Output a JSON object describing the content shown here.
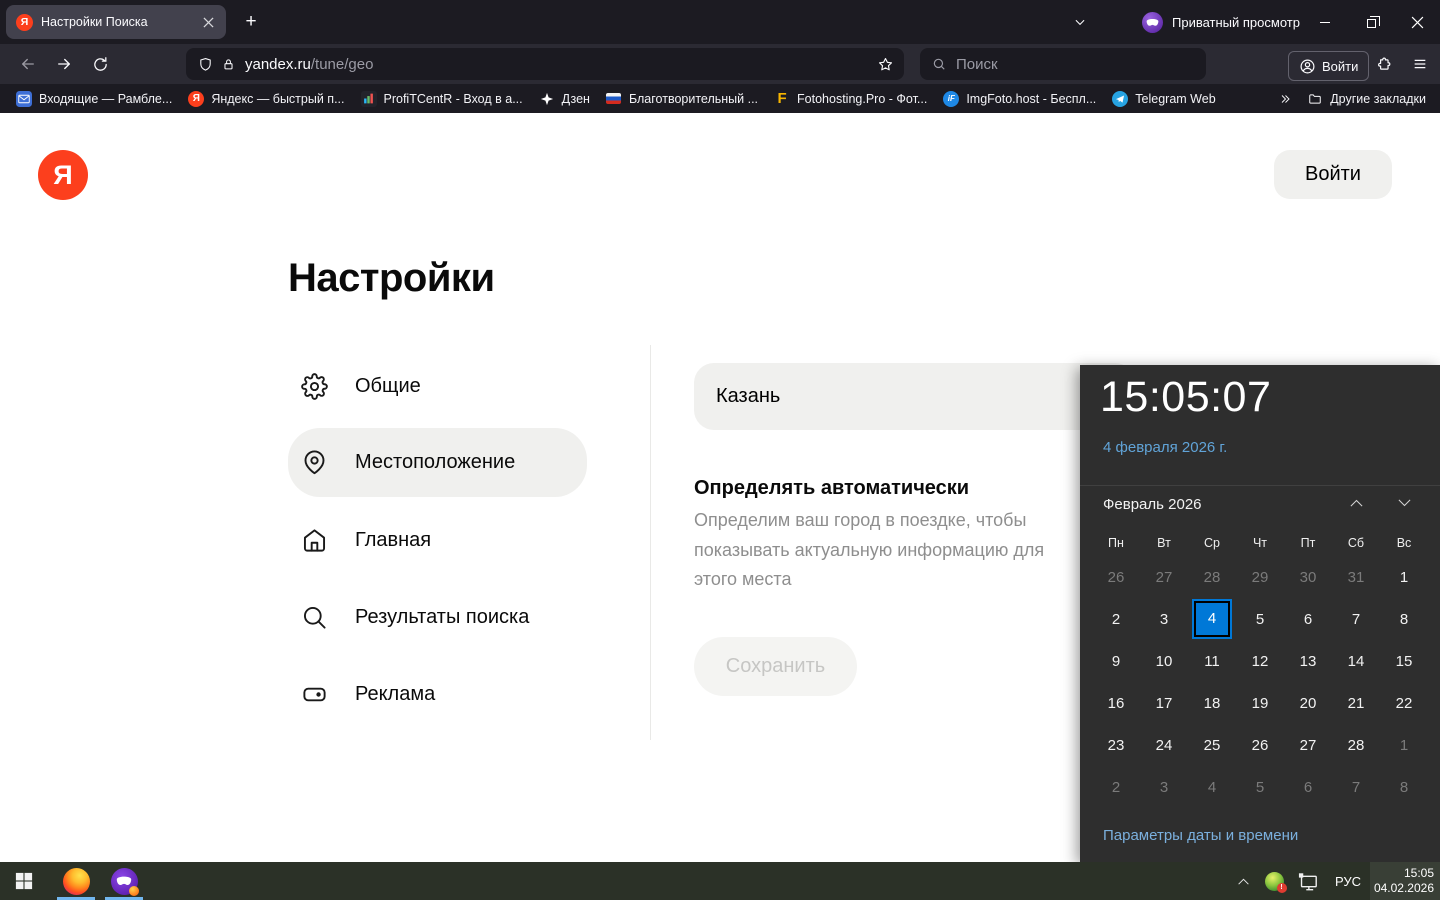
{
  "browser": {
    "tab": {
      "title": "Настройки Поиска"
    },
    "private_mode_label": "Приватный просмотр",
    "address": {
      "domain": "yandex.ru",
      "path": "/tune/geo"
    },
    "search_placeholder": "Поиск",
    "toolbar_signin_label": "Войти",
    "bookmarks": [
      {
        "icon": "mail",
        "label": "Входящие — Рамбле..."
      },
      {
        "icon": "yandex",
        "label": "Яндекс — быстрый п..."
      },
      {
        "icon": "chart",
        "label": "ProfiTCentR - Вход в а..."
      },
      {
        "icon": "zen",
        "label": "Дзен"
      },
      {
        "icon": "flag",
        "label": "Благотворительный ..."
      },
      {
        "icon": "foto",
        "label": "Fotohosting.Pro - Фот..."
      },
      {
        "icon": "imgfoto",
        "label": "ImgFoto.host - Беспл..."
      },
      {
        "icon": "telegram",
        "label": "Telegram Web"
      }
    ],
    "other_bookmarks_label": "Другие закладки"
  },
  "page": {
    "logo_letter": "Я",
    "signin_button_label": "Войти",
    "title": "Настройки",
    "sidebar": [
      {
        "id": "general",
        "icon": "gear",
        "label": "Общие",
        "active": false
      },
      {
        "id": "location",
        "icon": "pin",
        "label": "Местоположение",
        "active": true
      },
      {
        "id": "home",
        "icon": "home",
        "label": "Главная",
        "active": false
      },
      {
        "id": "results",
        "icon": "search",
        "label": "Результаты поиска",
        "active": false
      },
      {
        "id": "ads",
        "icon": "tag",
        "label": "Реклама",
        "active": false
      }
    ],
    "location_form": {
      "city_value": "Казань",
      "auto_heading": "Определять автоматически",
      "auto_description": "Определим ваш город в поездке, чтобы показывать актуальную информацию для этого места",
      "save_label": "Сохранить"
    }
  },
  "clock_flyout": {
    "time": "15:05:07",
    "date_label": "4 февраля 2026 г.",
    "month_label": "Февраль 2026",
    "weekdays": [
      "Пн",
      "Вт",
      "Ср",
      "Чт",
      "Пт",
      "Сб",
      "Вс"
    ],
    "days": [
      {
        "v": "26",
        "s": "dim"
      },
      {
        "v": "27",
        "s": "dim"
      },
      {
        "v": "28",
        "s": "dim"
      },
      {
        "v": "29",
        "s": "dim"
      },
      {
        "v": "30",
        "s": "dim"
      },
      {
        "v": "31",
        "s": "dim"
      },
      {
        "v": "1",
        "s": "cur"
      },
      {
        "v": "2",
        "s": "cur"
      },
      {
        "v": "3",
        "s": "cur"
      },
      {
        "v": "4",
        "s": "sel"
      },
      {
        "v": "5",
        "s": "cur"
      },
      {
        "v": "6",
        "s": "cur"
      },
      {
        "v": "7",
        "s": "cur"
      },
      {
        "v": "8",
        "s": "cur"
      },
      {
        "v": "9",
        "s": "cur"
      },
      {
        "v": "10",
        "s": "cur"
      },
      {
        "v": "11",
        "s": "cur"
      },
      {
        "v": "12",
        "s": "cur"
      },
      {
        "v": "13",
        "s": "cur"
      },
      {
        "v": "14",
        "s": "cur"
      },
      {
        "v": "15",
        "s": "cur"
      },
      {
        "v": "16",
        "s": "cur"
      },
      {
        "v": "17",
        "s": "cur"
      },
      {
        "v": "18",
        "s": "cur"
      },
      {
        "v": "19",
        "s": "cur"
      },
      {
        "v": "20",
        "s": "cur"
      },
      {
        "v": "21",
        "s": "cur"
      },
      {
        "v": "22",
        "s": "cur"
      },
      {
        "v": "23",
        "s": "cur"
      },
      {
        "v": "24",
        "s": "cur"
      },
      {
        "v": "25",
        "s": "cur"
      },
      {
        "v": "26",
        "s": "cur"
      },
      {
        "v": "27",
        "s": "cur"
      },
      {
        "v": "28",
        "s": "cur"
      },
      {
        "v": "1",
        "s": "dim"
      },
      {
        "v": "2",
        "s": "dim"
      },
      {
        "v": "3",
        "s": "dim"
      },
      {
        "v": "4",
        "s": "dim"
      },
      {
        "v": "5",
        "s": "dim"
      },
      {
        "v": "6",
        "s": "dim"
      },
      {
        "v": "7",
        "s": "dim"
      },
      {
        "v": "8",
        "s": "dim"
      }
    ],
    "footer_link": "Параметры даты и времени",
    "selected_day": "4",
    "accent_color": "#0078d7"
  },
  "taskbar": {
    "language_label": "РУС",
    "clock_time": "15:05",
    "clock_date": "04.02.2026"
  },
  "colors": {
    "yandex_red": "#fc3f1d",
    "selection_blue": "#0078d7",
    "taskbar_underline": "#72b7ee",
    "flyout_bg": "#2e2e2e"
  }
}
